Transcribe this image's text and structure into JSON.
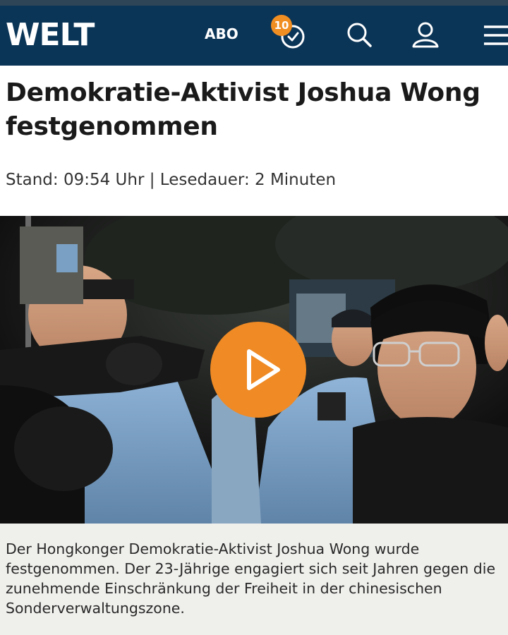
{
  "header": {
    "logo": "WELT",
    "abo_label": "ABO",
    "news_badge_count": "10",
    "icons": {
      "news": "stopwatch-icon",
      "search": "search-icon",
      "account": "user-icon",
      "menu": "hamburger-menu-icon"
    },
    "bar_color": "#0b3557"
  },
  "article": {
    "headline": "Demokratie-Aktivist Joshua Wong festgenommen",
    "meta": "Stand: 09:54 Uhr | Lesedauer: 2 Minuten",
    "video": {
      "play_icon": "play-icon",
      "play_button_color": "#f08a24"
    },
    "teaser": "Der Hongkonger Demokratie-Aktivist Joshua Wong wurde festgenommen. Der 23-Jährige engagiert sich seit Jahren gegen die zunehmende Einschränkung der Freiheit in der chinesischen Sonderverwaltungszone."
  }
}
